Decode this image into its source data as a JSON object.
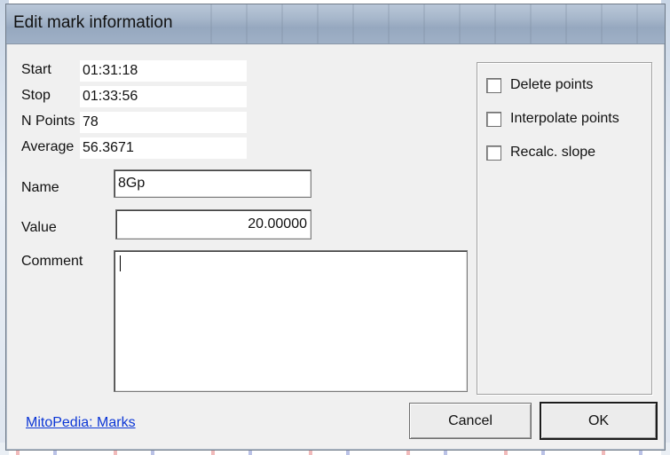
{
  "dialog": {
    "title": "Edit mark information"
  },
  "info": {
    "start_label": "Start",
    "start_value": "01:31:18",
    "stop_label": "Stop",
    "stop_value": "01:33:56",
    "npoints_label": "N Points",
    "npoints_value": "78",
    "average_label": "Average",
    "average_value": "56.3671"
  },
  "form": {
    "name_label": "Name",
    "name_value": "8Gp",
    "value_label": "Value",
    "value_value": "20.00000",
    "comment_label": "Comment",
    "comment_value": ""
  },
  "options": [
    {
      "label": "Delete points",
      "checked": false
    },
    {
      "label": "Interpolate points",
      "checked": false
    },
    {
      "label": "Recalc. slope",
      "checked": false
    }
  ],
  "footer": {
    "link_text": "MitoPedia: Marks",
    "cancel_label": "Cancel",
    "ok_label": "OK"
  },
  "colors": {
    "link": "#0b36d6",
    "dialog_bg": "#f0f0f0",
    "titlebar": "#a7b7cb"
  }
}
